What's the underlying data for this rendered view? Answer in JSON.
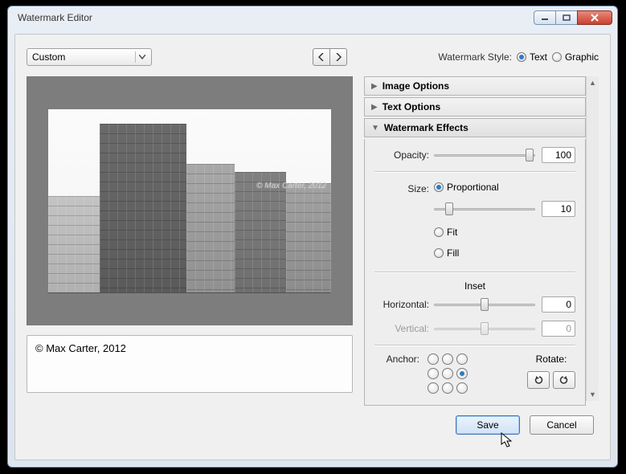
{
  "window": {
    "title": "Watermark Editor"
  },
  "preset": {
    "value": "Custom"
  },
  "style": {
    "label": "Watermark Style:",
    "text_label": "Text",
    "graphic_label": "Graphic",
    "selected": "Text"
  },
  "panels": {
    "image_options": "Image Options",
    "text_options": "Text Options",
    "watermark_effects": "Watermark Effects"
  },
  "effects": {
    "opacity_label": "Opacity:",
    "opacity_value": "100",
    "size_label": "Size:",
    "size_proportional": "Proportional",
    "size_value": "10",
    "size_fit": "Fit",
    "size_fill": "Fill",
    "inset_title": "Inset",
    "horizontal_label": "Horizontal:",
    "horizontal_value": "0",
    "vertical_label": "Vertical:",
    "vertical_value": "0",
    "anchor_label": "Anchor:",
    "rotate_label": "Rotate:"
  },
  "preview": {
    "watermark_overlay": "© Max Carter, 2012"
  },
  "text_input": {
    "value": "© Max Carter, 2012"
  },
  "footer": {
    "save": "Save",
    "cancel": "Cancel"
  }
}
